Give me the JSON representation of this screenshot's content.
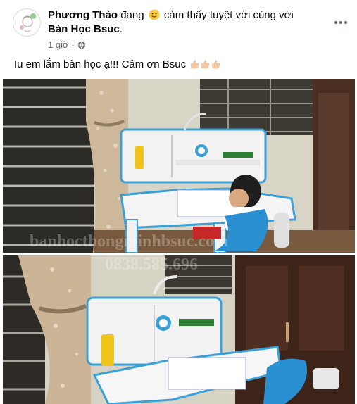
{
  "post": {
    "author": "Phương Thảo",
    "feeling_pre": "đang",
    "feeling_text": "cảm thấy tuyệt vời cùng với",
    "tagged": "Bàn Học Bsuc",
    "tagged_suffix": ".",
    "time": "1 giờ",
    "privacy_icon": "globe-icon",
    "more_icon": "more-options-icon",
    "caption": "Iu em lắm bàn học ạ!!! Cảm ơn Bsuc",
    "caption_emojis": [
      "thumbs-up-emoji",
      "thumbs-up-emoji",
      "thumbs-up-emoji"
    ]
  },
  "photos": {
    "watermark_1": "banhocthongminhbsuc.com",
    "watermark_2": "0838.585.696"
  },
  "colors": {
    "meta_gray": "#65676b",
    "text": "#050505",
    "desk_blue": "#3aa0d8"
  }
}
